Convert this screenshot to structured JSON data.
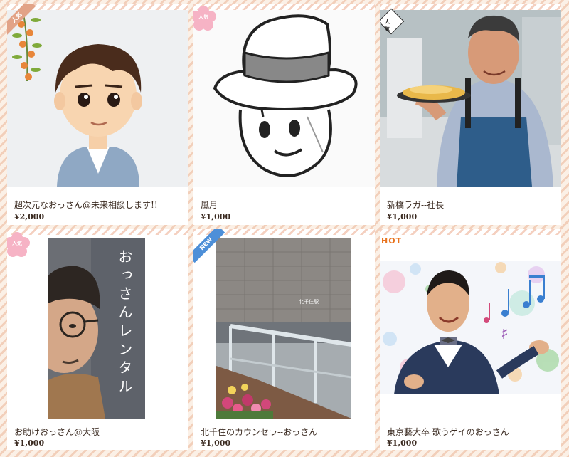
{
  "cards": [
    {
      "title": "超次元なおっさん@未来相談します!!",
      "price": "¥2,000",
      "badge": "人気",
      "badge_color": "#e2a387"
    },
    {
      "title": "風月",
      "price": "¥1,000",
      "badge": "人気",
      "badge_color": "#f6b3c5"
    },
    {
      "title": "新橋ラガ--社長",
      "price": "¥1,000",
      "badge": "人気",
      "badge_color": "#ffffff"
    },
    {
      "title": "お助けおっさん@大阪",
      "price": "¥1,000",
      "badge": "人気",
      "badge_color": "#f6b3c5",
      "image_text": "おっさんレンタル"
    },
    {
      "title": "北千住のカウンセラ--おっさん",
      "price": "¥1,000",
      "badge": "NEW",
      "badge_color": "#4d8fd8",
      "image_text": "北千住駅"
    },
    {
      "title": "東京藝大卒 歌うゲイのおっさん",
      "price": "¥1,000",
      "badge": "HOT",
      "badge_color": "#e8731e"
    }
  ]
}
